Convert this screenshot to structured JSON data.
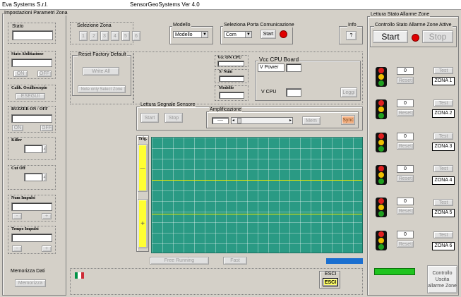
{
  "window": {
    "company": "Eva Systems S.r.l.",
    "app_title": "SensorGeoSystems  Ver 4.0"
  },
  "left_panel": {
    "title": "Impostazioni Parametri Zona",
    "stato": "Stato",
    "stato_abilitazione": "Stato Abilitazione",
    "on": "ON",
    "off": "OFF",
    "calib": "Calib. Oscilloscopio",
    "esegui": "ESEGUI",
    "buzzer": "BUZZER  ON / OFF",
    "buzzer_on": "ON",
    "buzzer_off": "OFF",
    "killer": "Killer",
    "cut_off": "Cut Off",
    "num_impulsi": "Num Impulsi",
    "tempo_impulsi": "Tempo Impulsi",
    "minus": "-",
    "plus": "+",
    "memorizza_title": "Memorizza Dati",
    "memorizza": "Memorizza"
  },
  "selezione_zona": {
    "title": "Selezione   Zona",
    "zones": [
      "1",
      "2",
      "3",
      "4",
      "5",
      "6"
    ]
  },
  "modello": {
    "title": "Modello",
    "value": "Modello"
  },
  "porta": {
    "title": "Seleziona Porta Comunicazione",
    "value": "Com",
    "start": "Start"
  },
  "info": {
    "title": "Info",
    "button": "?"
  },
  "reset_factory": {
    "title": "Reset Factory Default",
    "write_all": "Write All",
    "note": "Note only Select Zone"
  },
  "small_fields": {
    "vcc_ch": "Vcc  ON CPU",
    "sn": "S/ Num",
    "modello": "Modello"
  },
  "vcc_cpu": {
    "title": "Vcc  CPU Board",
    "v_power": "V Power",
    "v_cpu": "V CPU",
    "leggi": "Leggi"
  },
  "lettura": {
    "title": "Lettura Segnale Sensore",
    "start": "Start",
    "stop": "Stop",
    "amplificazione": "Amplificazione",
    "value": "----",
    "mem": "Mem",
    "sync": "Sync"
  },
  "trig": {
    "label": "Trig.",
    "minus": "—",
    "plus": "+"
  },
  "scope_buttons": {
    "free_running": "Free Running",
    "fast": "Fast"
  },
  "esci": {
    "label": "ESCI",
    "button": "ESCI"
  },
  "right_panel": {
    "title": "Lettura Stato Allarme Zone",
    "control_title": "Controllo Stato Allarme Zone Attive",
    "start": "Start",
    "stop": "Stop",
    "zones": [
      {
        "value": "0",
        "reset": "Reset",
        "test": "Test",
        "name": "ZONA 1"
      },
      {
        "value": "0",
        "reset": "Reset",
        "test": "Test",
        "name": "ZONA 2"
      },
      {
        "value": "0",
        "reset": "Reset",
        "test": "Test",
        "name": "ZONA 3"
      },
      {
        "value": "0",
        "reset": "Reset",
        "test": "Test",
        "name": "ZONA 4"
      },
      {
        "value": "0",
        "reset": "Reset",
        "test": "Test",
        "name": "ZONA 5"
      },
      {
        "value": "0",
        "reset": "Reset",
        "test": "Test",
        "name": "ZONA 6"
      }
    ],
    "controllo_uscita": "Controllo Uscita allarme Zone"
  },
  "colors": {
    "scope_bg": "#2a9a84",
    "trig_yellow": "#ffff33",
    "status_green": "#1fc41f",
    "status_blue": "#1a6fd0",
    "led_red": "#e00000",
    "sync_orange": "#f4b183"
  }
}
